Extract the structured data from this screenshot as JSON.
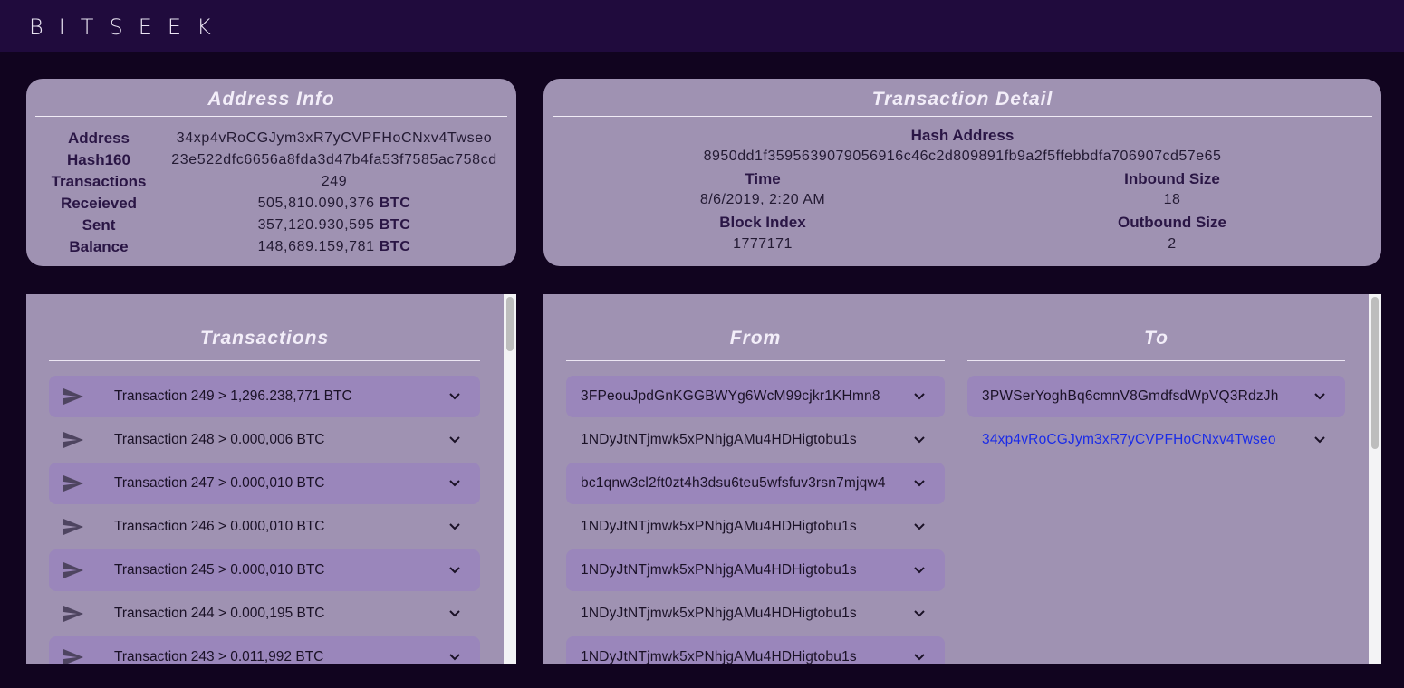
{
  "app": {
    "brand": "BITSEEK"
  },
  "address_info": {
    "title": "Address Info",
    "rows": [
      {
        "label": "Address",
        "value": "34xp4vRoCGJym3xR7yCVPFHoCNxv4Twseo",
        "unit": ""
      },
      {
        "label": "Hash160",
        "value": "23e522dfc6656a8fda3d47b4fa53f7585ac758cd",
        "unit": ""
      },
      {
        "label": "Transactions",
        "value": "249",
        "unit": ""
      },
      {
        "label": "Receieved",
        "value": "505,810.090,376",
        "unit": "BTC"
      },
      {
        "label": "Sent",
        "value": "357,120.930,595",
        "unit": "BTC"
      },
      {
        "label": "Balance",
        "value": "148,689.159,781",
        "unit": "BTC"
      }
    ]
  },
  "transaction_detail": {
    "title": "Transaction Detail",
    "hash_label": "Hash Address",
    "hash_value": "8950dd1f3595639079056916c46c2d809891fb9a2f5ffebbdfa706907cd57e65",
    "time_label": "Time",
    "time_value": "8/6/2019, 2:20 AM",
    "inbound_label": "Inbound Size",
    "inbound_value": "18",
    "block_label": "Block Index",
    "block_value": "1777171",
    "outbound_label": "Outbound Size",
    "outbound_value": "2"
  },
  "transactions_panel": {
    "title": "Transactions",
    "items": [
      {
        "label": "Transaction 249 > 1,296.238,771 BTC",
        "shaded": true
      },
      {
        "label": "Transaction 248 > 0.000,006 BTC",
        "shaded": false
      },
      {
        "label": "Transaction 247 > 0.000,010 BTC",
        "shaded": true
      },
      {
        "label": "Transaction 246 > 0.000,010 BTC",
        "shaded": false
      },
      {
        "label": "Transaction 245 > 0.000,010 BTC",
        "shaded": true
      },
      {
        "label": "Transaction 244 > 0.000,195 BTC",
        "shaded": false
      },
      {
        "label": "Transaction 243 > 0.011,992 BTC",
        "shaded": true
      }
    ]
  },
  "from_panel": {
    "title": "From",
    "items": [
      {
        "label": "3FPeouJpdGnKGGBWYg6WcM99cjkr1KHmn8",
        "shaded": true
      },
      {
        "label": "1NDyJtNTjmwk5xPNhjgAMu4HDHigtobu1s",
        "shaded": false
      },
      {
        "label": "bc1qnw3cl2ft0zt4h3dsu6teu5wfsfuv3rsn7mjqw4",
        "shaded": true
      },
      {
        "label": "1NDyJtNTjmwk5xPNhjgAMu4HDHigtobu1s",
        "shaded": false
      },
      {
        "label": "1NDyJtNTjmwk5xPNhjgAMu4HDHigtobu1s",
        "shaded": true
      },
      {
        "label": "1NDyJtNTjmwk5xPNhjgAMu4HDHigtobu1s",
        "shaded": false
      },
      {
        "label": "1NDyJtNTjmwk5xPNhjgAMu4HDHigtobu1s",
        "shaded": true
      }
    ]
  },
  "to_panel": {
    "title": "To",
    "items": [
      {
        "label": "3PWSerYoghBq6cmnV8GmdfsdWpVQ3RdzJh",
        "shaded": true,
        "link": false
      },
      {
        "label": "34xp4vRoCGJym3xR7yCVPFHoCNxv4Twseo",
        "shaded": false,
        "link": true
      }
    ]
  },
  "icons": {
    "transaction": "send-icon",
    "expand": "chevron-down-icon"
  },
  "colors": {
    "background": "#11041f",
    "appbar": "#200b3d",
    "card": "#9f92b2",
    "row_shaded": "#9a86bb",
    "link": "#1a2be8"
  }
}
